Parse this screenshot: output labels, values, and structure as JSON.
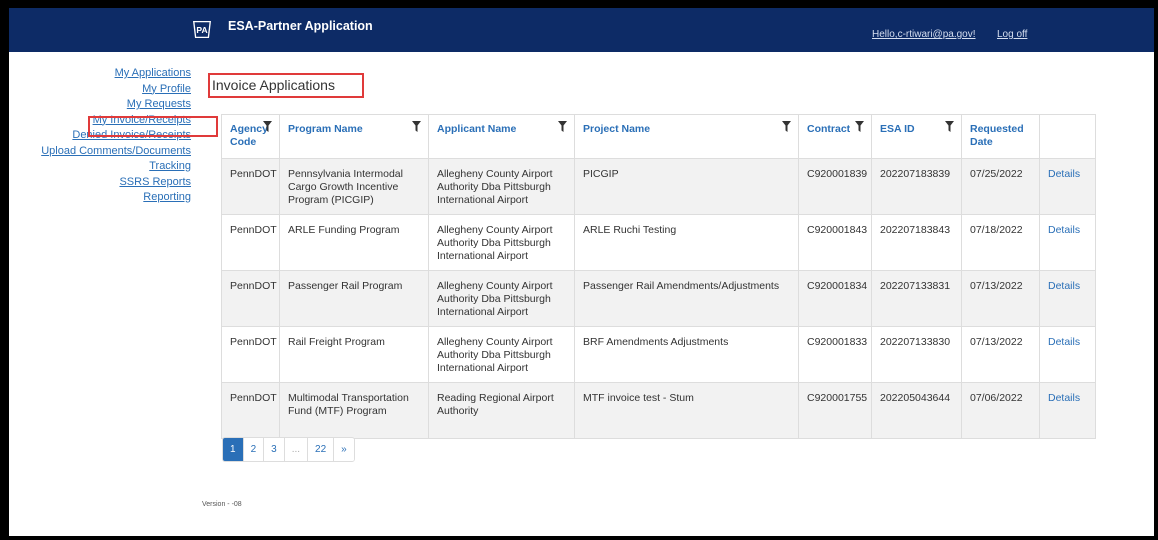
{
  "header": {
    "title": "ESA-Partner Application",
    "logo_text": "PA",
    "greeting": "Hello,c-rtiwari@pa.gov!",
    "logoff": "Log off"
  },
  "sidebar": {
    "items": [
      {
        "label": "My Applications"
      },
      {
        "label": "My Profile"
      },
      {
        "label": "My Requests"
      },
      {
        "label": "My Invoice/Receipts",
        "selected": true
      },
      {
        "label": "Denied Invoice/Receipts"
      },
      {
        "label": "Upload Comments/Documents"
      },
      {
        "label": "Tracking"
      },
      {
        "label": "SSRS Reports"
      },
      {
        "label": "Reporting"
      }
    ]
  },
  "main": {
    "title": "Invoice Applications",
    "table": {
      "columns": [
        {
          "label": "Agency Code",
          "filterable": true
        },
        {
          "label": "Program Name",
          "filterable": true
        },
        {
          "label": "Applicant Name",
          "filterable": true
        },
        {
          "label": "Project Name",
          "filterable": true
        },
        {
          "label": "Contract",
          "filterable": true
        },
        {
          "label": "ESA ID",
          "filterable": true
        },
        {
          "label": "Requested Date",
          "filterable": false
        },
        {
          "label": "",
          "filterable": false
        }
      ],
      "rows": [
        {
          "agency": "PennDOT",
          "program": "Pennsylvania Intermodal Cargo Growth Incentive Program (PICGIP)",
          "applicant": "Allegheny County Airport Authority Dba Pittsburgh International Airport",
          "project": "PICGIP",
          "contract": "C920001839",
          "esa_id": "202207183839",
          "date": "07/25/2022",
          "action": "Details"
        },
        {
          "agency": "PennDOT",
          "program": "ARLE Funding Program",
          "applicant": "Allegheny County Airport Authority Dba Pittsburgh International Airport",
          "project": "ARLE Ruchi Testing",
          "contract": "C920001843",
          "esa_id": "202207183843",
          "date": "07/18/2022",
          "action": "Details"
        },
        {
          "agency": "PennDOT",
          "program": "Passenger Rail Program",
          "applicant": "Allegheny County Airport Authority Dba Pittsburgh International Airport",
          "project": "Passenger Rail Amendments/Adjustments",
          "contract": "C920001834",
          "esa_id": "202207133831",
          "date": "07/13/2022",
          "action": "Details"
        },
        {
          "agency": "PennDOT",
          "program": "Rail Freight Program",
          "applicant": "Allegheny County Airport Authority Dba Pittsburgh International Airport",
          "project": "BRF Amendments Adjustments",
          "contract": "C920001833",
          "esa_id": "202207133830",
          "date": "07/13/2022",
          "action": "Details"
        },
        {
          "agency": "PennDOT",
          "program": "Multimodal Transportation Fund (MTF) Program",
          "applicant": "Reading Regional Airport Authority",
          "project": "MTF invoice test - Stum",
          "contract": "C920001755",
          "esa_id": "202205043644",
          "date": "07/06/2022",
          "action": "Details"
        }
      ]
    },
    "pagination": {
      "pages": [
        "1",
        "2",
        "3",
        "...",
        "22",
        "»"
      ],
      "current": "1"
    }
  },
  "footer": {
    "version": "Version - -08"
  },
  "colors": {
    "navbar": "#0d2b66",
    "link": "#2a6fb7",
    "highlight": "#e03a3a"
  }
}
